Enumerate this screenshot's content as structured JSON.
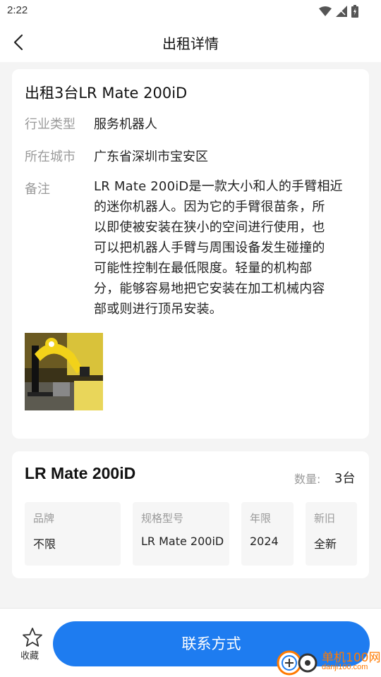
{
  "status_bar": {
    "time": "2:22"
  },
  "nav": {
    "title": "出租详情"
  },
  "listing": {
    "title": "出租3台LR Mate 200iD",
    "industry_label": "行业类型",
    "industry_value": "服务机器人",
    "city_label": "所在城市",
    "city_value": "广东省深圳市宝安区",
    "remark_label": "备注",
    "remark_lines": [
      "LR Mate 200iD是一款大小和人的手臂相近",
      "的迷你机器人。因为它的手臂很苗条，所",
      "以即使被安装在狭小的空间进行使用，也",
      "可以把机器人手臂与周围设备发生碰撞的",
      "可能性控制在最低限度。轻量的机构部",
      "分，能够容易地把它安装在加工机械内容",
      "部或则进行顶吊安装。"
    ]
  },
  "product": {
    "model": "LR Mate 200iD",
    "qty_label": "数量:",
    "qty_value": "3台",
    "specs": [
      {
        "label": "品牌",
        "value": "不限"
      },
      {
        "label": "规格型号",
        "value": "LR Mate 200iD"
      },
      {
        "label": "年限",
        "value": "2024"
      },
      {
        "label": "新旧",
        "value": "全新"
      }
    ]
  },
  "bottom": {
    "favorite_label": "收藏",
    "contact_label": "联系方式"
  },
  "watermark": {
    "name": "单机100网",
    "url": "danji100.com"
  },
  "colors": {
    "accent": "#1e7cf0",
    "watermark": "#ff7a00"
  }
}
